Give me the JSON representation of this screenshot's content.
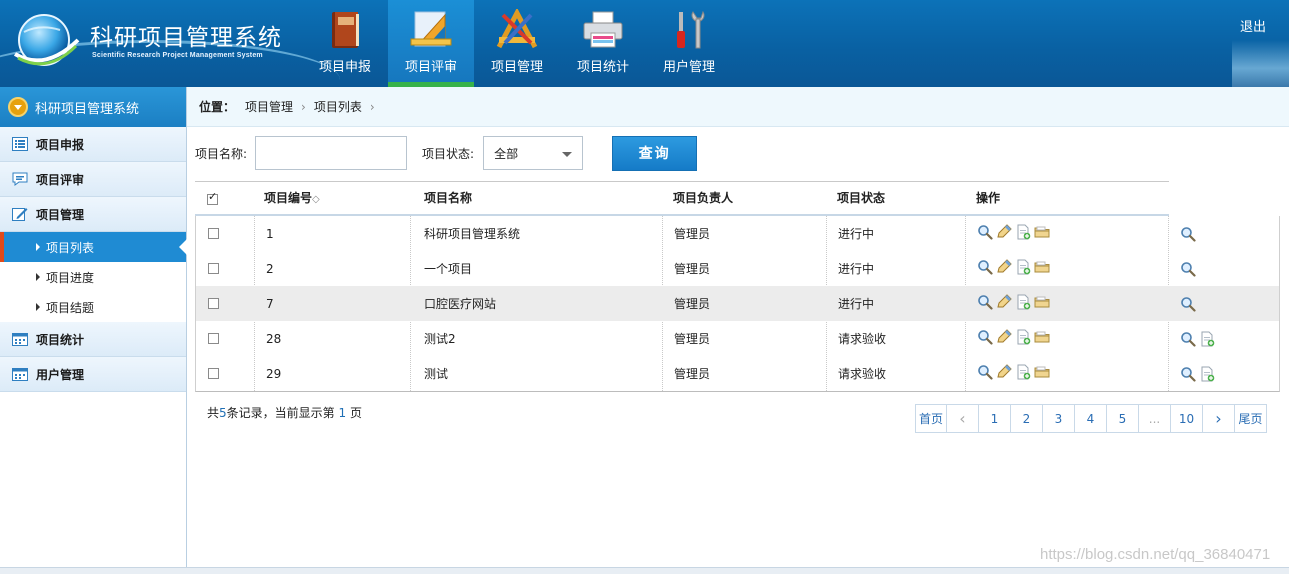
{
  "app": {
    "title": "科研项目管理系统",
    "subtitle": "Scientific Research Project Management System",
    "logout": "退出"
  },
  "nav": [
    {
      "label": "项目申报",
      "icon": "book-icon"
    },
    {
      "label": "项目评审",
      "icon": "ruler-triangle-icon"
    },
    {
      "label": "项目管理",
      "icon": "drafting-tools-icon"
    },
    {
      "label": "项目统计",
      "icon": "printer-icon"
    },
    {
      "label": "用户管理",
      "icon": "tools-icon"
    }
  ],
  "sidebar": {
    "title": "科研项目管理系统",
    "groups": [
      {
        "label": "项目申报",
        "icon": "list-icon"
      },
      {
        "label": "项目评审",
        "icon": "comment-icon"
      },
      {
        "label": "项目管理",
        "icon": "edit-icon"
      },
      {
        "label": "项目统计",
        "icon": "calendar-icon"
      },
      {
        "label": "用户管理",
        "icon": "calendar-icon"
      }
    ],
    "subitems": [
      "项目列表",
      "项目进度",
      "项目结题"
    ]
  },
  "breadcrumb": {
    "prefix": "位置：",
    "items": [
      "项目管理",
      "项目列表"
    ],
    "sep": "›"
  },
  "search": {
    "name_label": "项目名称:",
    "name_value": "",
    "status_label": "项目状态:",
    "status_value": "全部",
    "query_button": "查询"
  },
  "table": {
    "headers": {
      "id": "项目编号",
      "sort_mark": "◇",
      "name": "项目名称",
      "owner": "项目负责人",
      "status": "项目状态",
      "ops": "操作"
    },
    "rows": [
      {
        "id": "1",
        "name": "科研项目管理系统",
        "owner": "管理员",
        "status": "进行中",
        "highlight": false,
        "extra": [
          "search"
        ]
      },
      {
        "id": "2",
        "name": "一个项目",
        "owner": "管理员",
        "status": "进行中",
        "highlight": false,
        "extra": [
          "search"
        ]
      },
      {
        "id": "7",
        "name": "口腔医疗网站",
        "owner": "管理员",
        "status": "进行中",
        "highlight": true,
        "extra": [
          "search"
        ]
      },
      {
        "id": "28",
        "name": "测试2",
        "owner": "管理员",
        "status": "请求验收",
        "highlight": false,
        "extra": [
          "search",
          "doc"
        ]
      },
      {
        "id": "29",
        "name": "测试",
        "owner": "管理员",
        "status": "请求验收",
        "highlight": false,
        "extra": [
          "search",
          "doc"
        ]
      }
    ]
  },
  "footer": {
    "records_prefix": "共",
    "records_count": "5",
    "records_mid": "条记录，当前显示第",
    "current_page": "1",
    "records_suffix": "页",
    "pages": [
      "首页",
      "‹",
      "1",
      "2",
      "3",
      "4",
      "5",
      "...",
      "10",
      "›",
      "尾页"
    ]
  },
  "watermark": "https://blog.csdn.net/qq_36840471"
}
